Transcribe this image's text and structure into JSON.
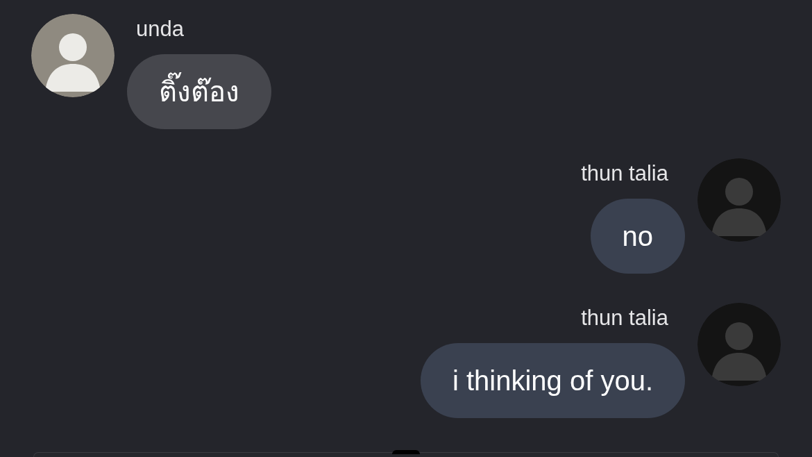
{
  "messages": [
    {
      "kind": "incoming",
      "sender": "unda",
      "text": "ติ๊งต๊อง"
    },
    {
      "kind": "outgoing",
      "sender": "thun talia",
      "text": "no"
    },
    {
      "kind": "outgoing",
      "sender": "thun talia",
      "text": "i thinking of you."
    }
  ],
  "composer": {
    "kind": "field"
  }
}
